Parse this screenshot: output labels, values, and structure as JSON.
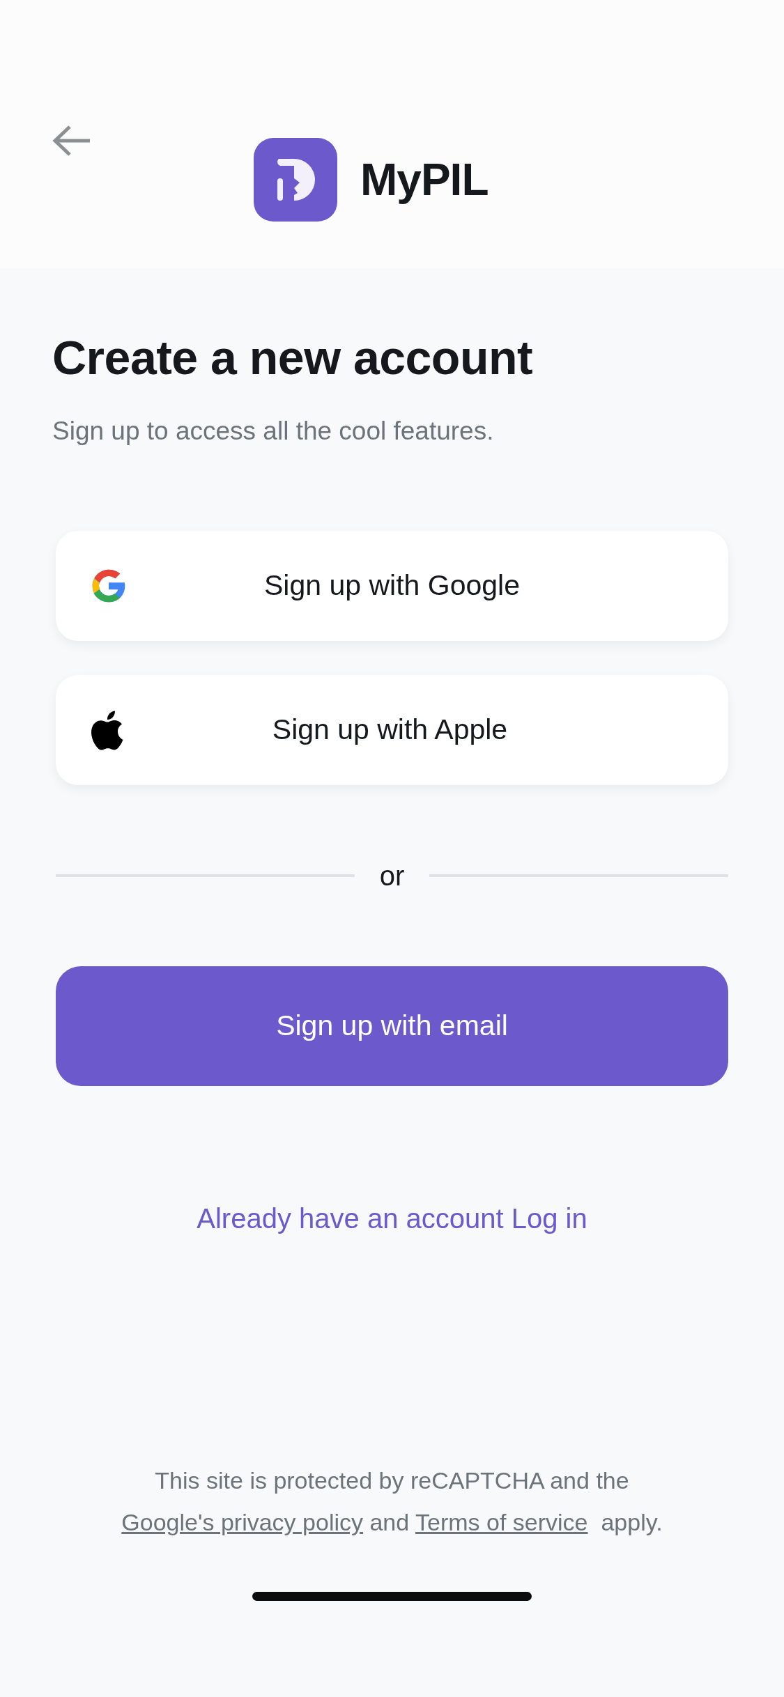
{
  "header": {
    "brand": "MyPIL"
  },
  "title": "Create a new account",
  "subtitle": "Sign up to access all the cool features.",
  "social_buttons": [
    {
      "kind": "google",
      "label": "Sign up with Google"
    },
    {
      "kind": "apple",
      "label": "Sign up with Apple"
    }
  ],
  "divider": "or",
  "email_button": "Sign up with email",
  "login_link": "Already have an account Log in",
  "footer": {
    "line_1": "This site is protected by reCAPTCHA and the",
    "privacy_link": "Google's privacy policy",
    "and": "and",
    "terms_link": "Terms of service",
    "apply": "apply."
  }
}
